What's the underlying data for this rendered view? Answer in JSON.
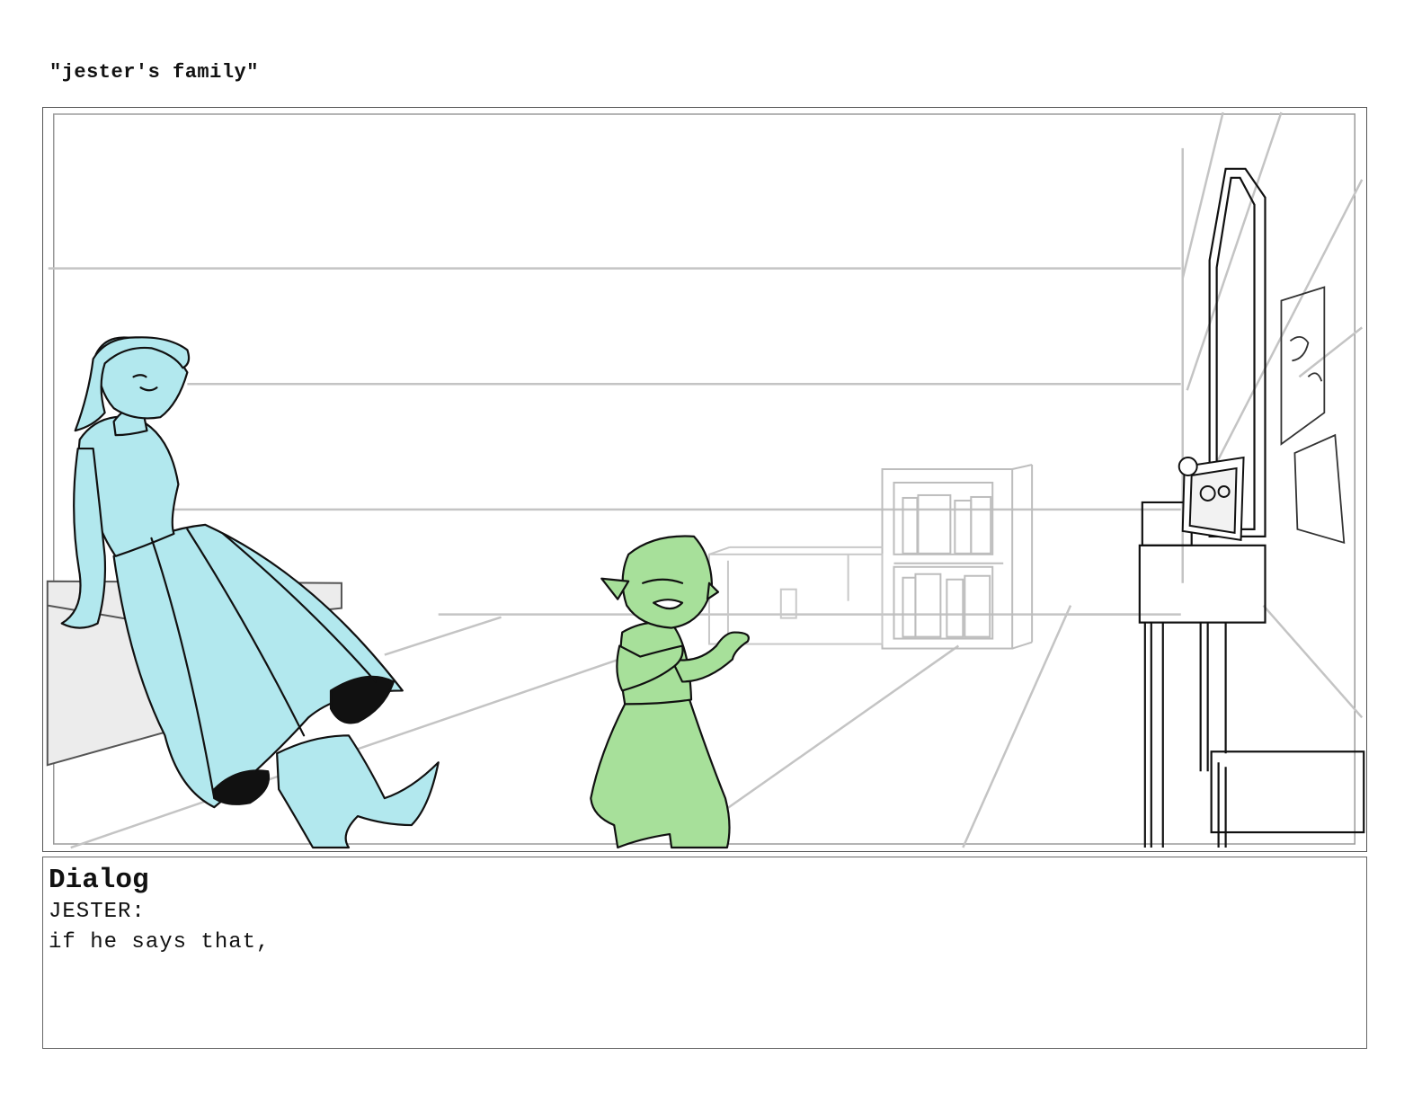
{
  "page": {
    "title": "\"jester's family\""
  },
  "panel": {
    "characters": [
      "blue-tiefling-woman",
      "green-goblin-child"
    ],
    "colors": {
      "blue_character": "#b2e8ee",
      "green_character": "#a7e09a",
      "line": "#111111",
      "background_line": "#c4c4c4"
    }
  },
  "dialog": {
    "heading": "Dialog",
    "speaker": "JESTER:",
    "line": "if he says that,"
  }
}
